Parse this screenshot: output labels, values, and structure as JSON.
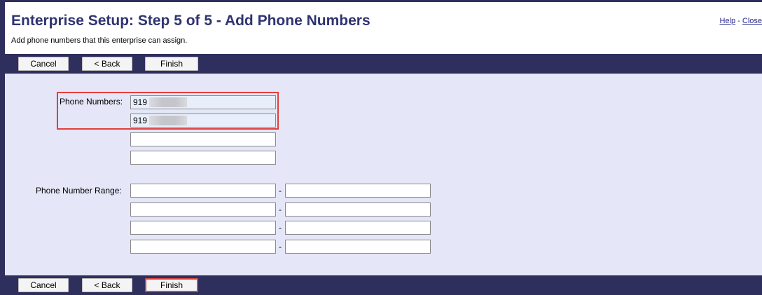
{
  "header": {
    "title": "Enterprise Setup: Step 5 of 5 - Add Phone Numbers",
    "subtitle": "Add phone numbers that this enterprise can assign.",
    "help_label": "Help",
    "separator": "-",
    "close_label": "Close"
  },
  "toolbar": {
    "cancel_label": "Cancel",
    "back_label": "< Back",
    "finish_label": "Finish"
  },
  "form": {
    "phone_numbers_label": "Phone Numbers:",
    "phone_numbers": [
      "919",
      "919",
      "",
      ""
    ],
    "range_label": "Phone Number Range:",
    "range_separator": "-",
    "ranges": [
      {
        "from": "",
        "to": ""
      },
      {
        "from": "",
        "to": ""
      },
      {
        "from": "",
        "to": ""
      },
      {
        "from": "",
        "to": ""
      }
    ]
  },
  "colors": {
    "title": "#2f3470",
    "bar": "#2f2f5e",
    "content_bg": "#e5e6f7",
    "highlight": "#e0413b"
  }
}
